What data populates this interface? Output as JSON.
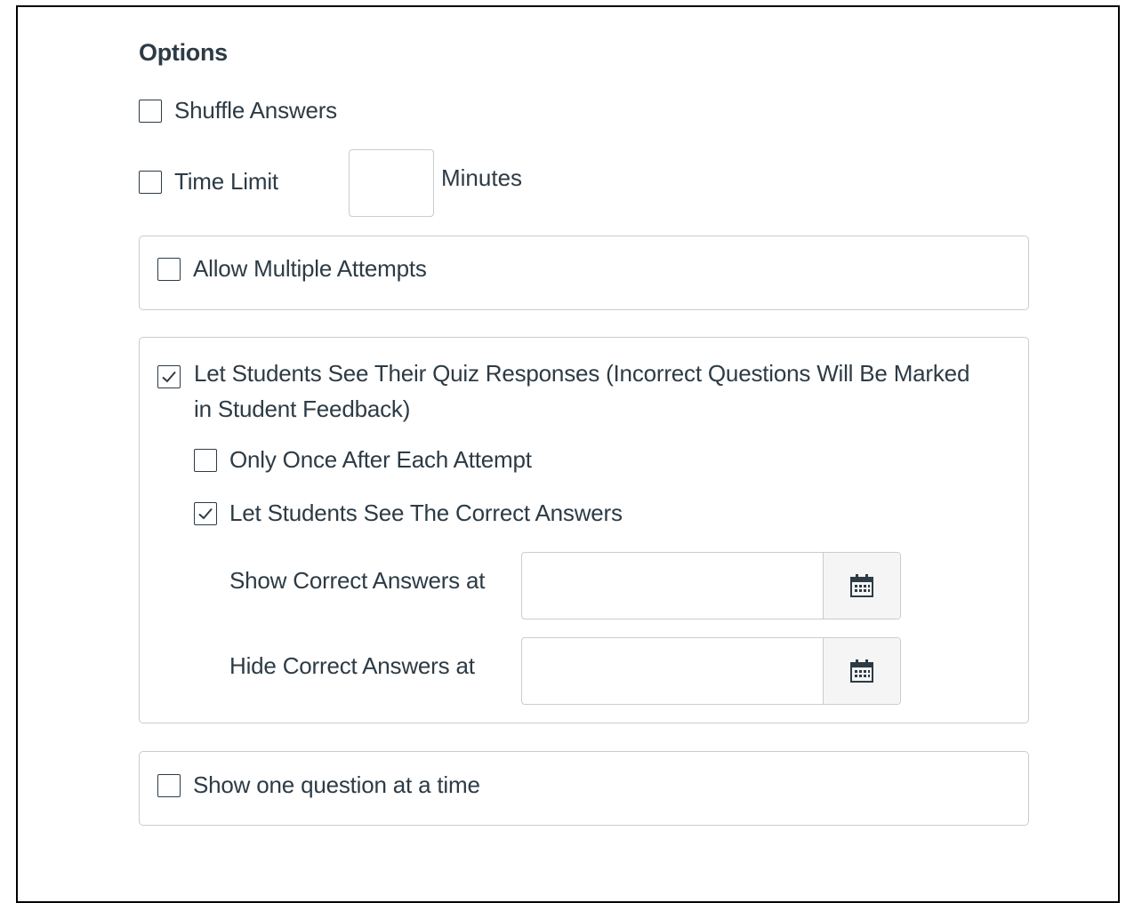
{
  "options": {
    "heading": "Options",
    "shuffle_answers": {
      "label": "Shuffle Answers",
      "checked": false
    },
    "time_limit": {
      "label": "Time Limit",
      "value": "",
      "unit": "Minutes",
      "checked": false
    },
    "allow_multiple_attempts": {
      "label": "Allow Multiple Attempts",
      "checked": false
    },
    "see_responses": {
      "label": "Let Students See Their Quiz Responses (Incorrect Questions Will Be Marked in Student Feedback)",
      "checked": true,
      "only_once": {
        "label": "Only Once After Each Attempt",
        "checked": false
      },
      "see_correct": {
        "label": "Let Students See The Correct Answers",
        "checked": true
      },
      "show_correct_at": {
        "label": "Show Correct Answers at",
        "value": ""
      },
      "hide_correct_at": {
        "label": "Hide Correct Answers at",
        "value": ""
      }
    },
    "one_question": {
      "label": "Show one question at a time",
      "checked": false
    }
  },
  "colors": {
    "text": "#2d3b45",
    "border": "#c7cdd1",
    "button_bg": "#f5f5f5"
  },
  "icons": {
    "calendar": "calendar-icon",
    "check": "checkmark-icon"
  }
}
